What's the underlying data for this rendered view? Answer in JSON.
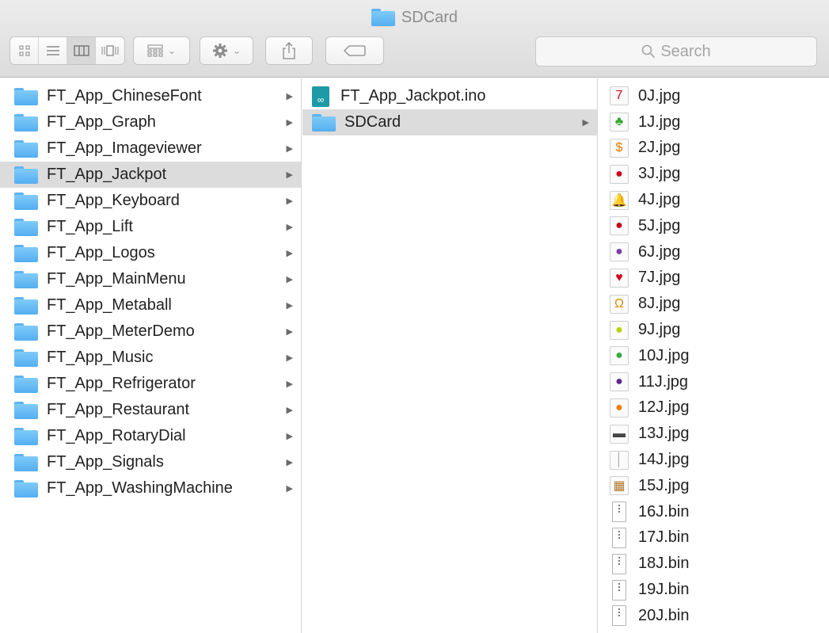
{
  "window": {
    "title": "SDCard"
  },
  "toolbar": {
    "view_buttons": [
      "icon-view-icon",
      "list-view-icon",
      "column-view-icon",
      "cover-flow-icon"
    ],
    "active_view": "column-view-icon",
    "search_placeholder": "Search"
  },
  "columns": {
    "col1": [
      {
        "label": "FT_App_ChineseFont"
      },
      {
        "label": "FT_App_Graph"
      },
      {
        "label": "FT_App_Imageviewer"
      },
      {
        "label": "FT_App_Jackpot",
        "selected": true
      },
      {
        "label": "FT_App_Keyboard"
      },
      {
        "label": "FT_App_Lift"
      },
      {
        "label": "FT_App_Logos"
      },
      {
        "label": "FT_App_MainMenu"
      },
      {
        "label": "FT_App_Metaball"
      },
      {
        "label": "FT_App_MeterDemo"
      },
      {
        "label": "FT_App_Music"
      },
      {
        "label": "FT_App_Refrigerator"
      },
      {
        "label": "FT_App_Restaurant"
      },
      {
        "label": "FT_App_RotaryDial"
      },
      {
        "label": "FT_App_Signals"
      },
      {
        "label": "FT_App_WashingMachine"
      }
    ],
    "col2": [
      {
        "label": "FT_App_Jackpot.ino",
        "kind": "ino"
      },
      {
        "label": "SDCard",
        "kind": "folder",
        "selected": true
      }
    ],
    "col3": [
      {
        "label": "0J.jpg",
        "icon": "7",
        "color": "#d0021b"
      },
      {
        "label": "1J.jpg",
        "icon": "♣",
        "color": "#2fa82f"
      },
      {
        "label": "2J.jpg",
        "icon": "$",
        "color": "#e07a00"
      },
      {
        "label": "3J.jpg",
        "icon": "●",
        "color": "#d0021b"
      },
      {
        "label": "4J.jpg",
        "icon": "🔔",
        "color": "#c98500"
      },
      {
        "label": "5J.jpg",
        "icon": "●",
        "color": "#c0001a"
      },
      {
        "label": "6J.jpg",
        "icon": "●",
        "color": "#7d3fa6"
      },
      {
        "label": "7J.jpg",
        "icon": "♥",
        "color": "#d0021b"
      },
      {
        "label": "8J.jpg",
        "icon": "Ω",
        "color": "#d98c00"
      },
      {
        "label": "9J.jpg",
        "icon": "●",
        "color": "#b6d400"
      },
      {
        "label": "10J.jpg",
        "icon": "●",
        "color": "#39a845"
      },
      {
        "label": "11J.jpg",
        "icon": "●",
        "color": "#5b2a8c"
      },
      {
        "label": "12J.jpg",
        "icon": "●",
        "color": "#f07d00"
      },
      {
        "label": "13J.jpg",
        "icon": "▬",
        "color": "#444444"
      },
      {
        "label": "14J.jpg",
        "icon": "│",
        "color": "#aaaaaa"
      },
      {
        "label": "15J.jpg",
        "icon": "▦",
        "color": "#b07a2c"
      },
      {
        "label": "16J.bin",
        "kind": "bin"
      },
      {
        "label": "17J.bin",
        "kind": "bin"
      },
      {
        "label": "18J.bin",
        "kind": "bin"
      },
      {
        "label": "19J.bin",
        "kind": "bin"
      },
      {
        "label": "20J.bin",
        "kind": "bin"
      }
    ]
  }
}
